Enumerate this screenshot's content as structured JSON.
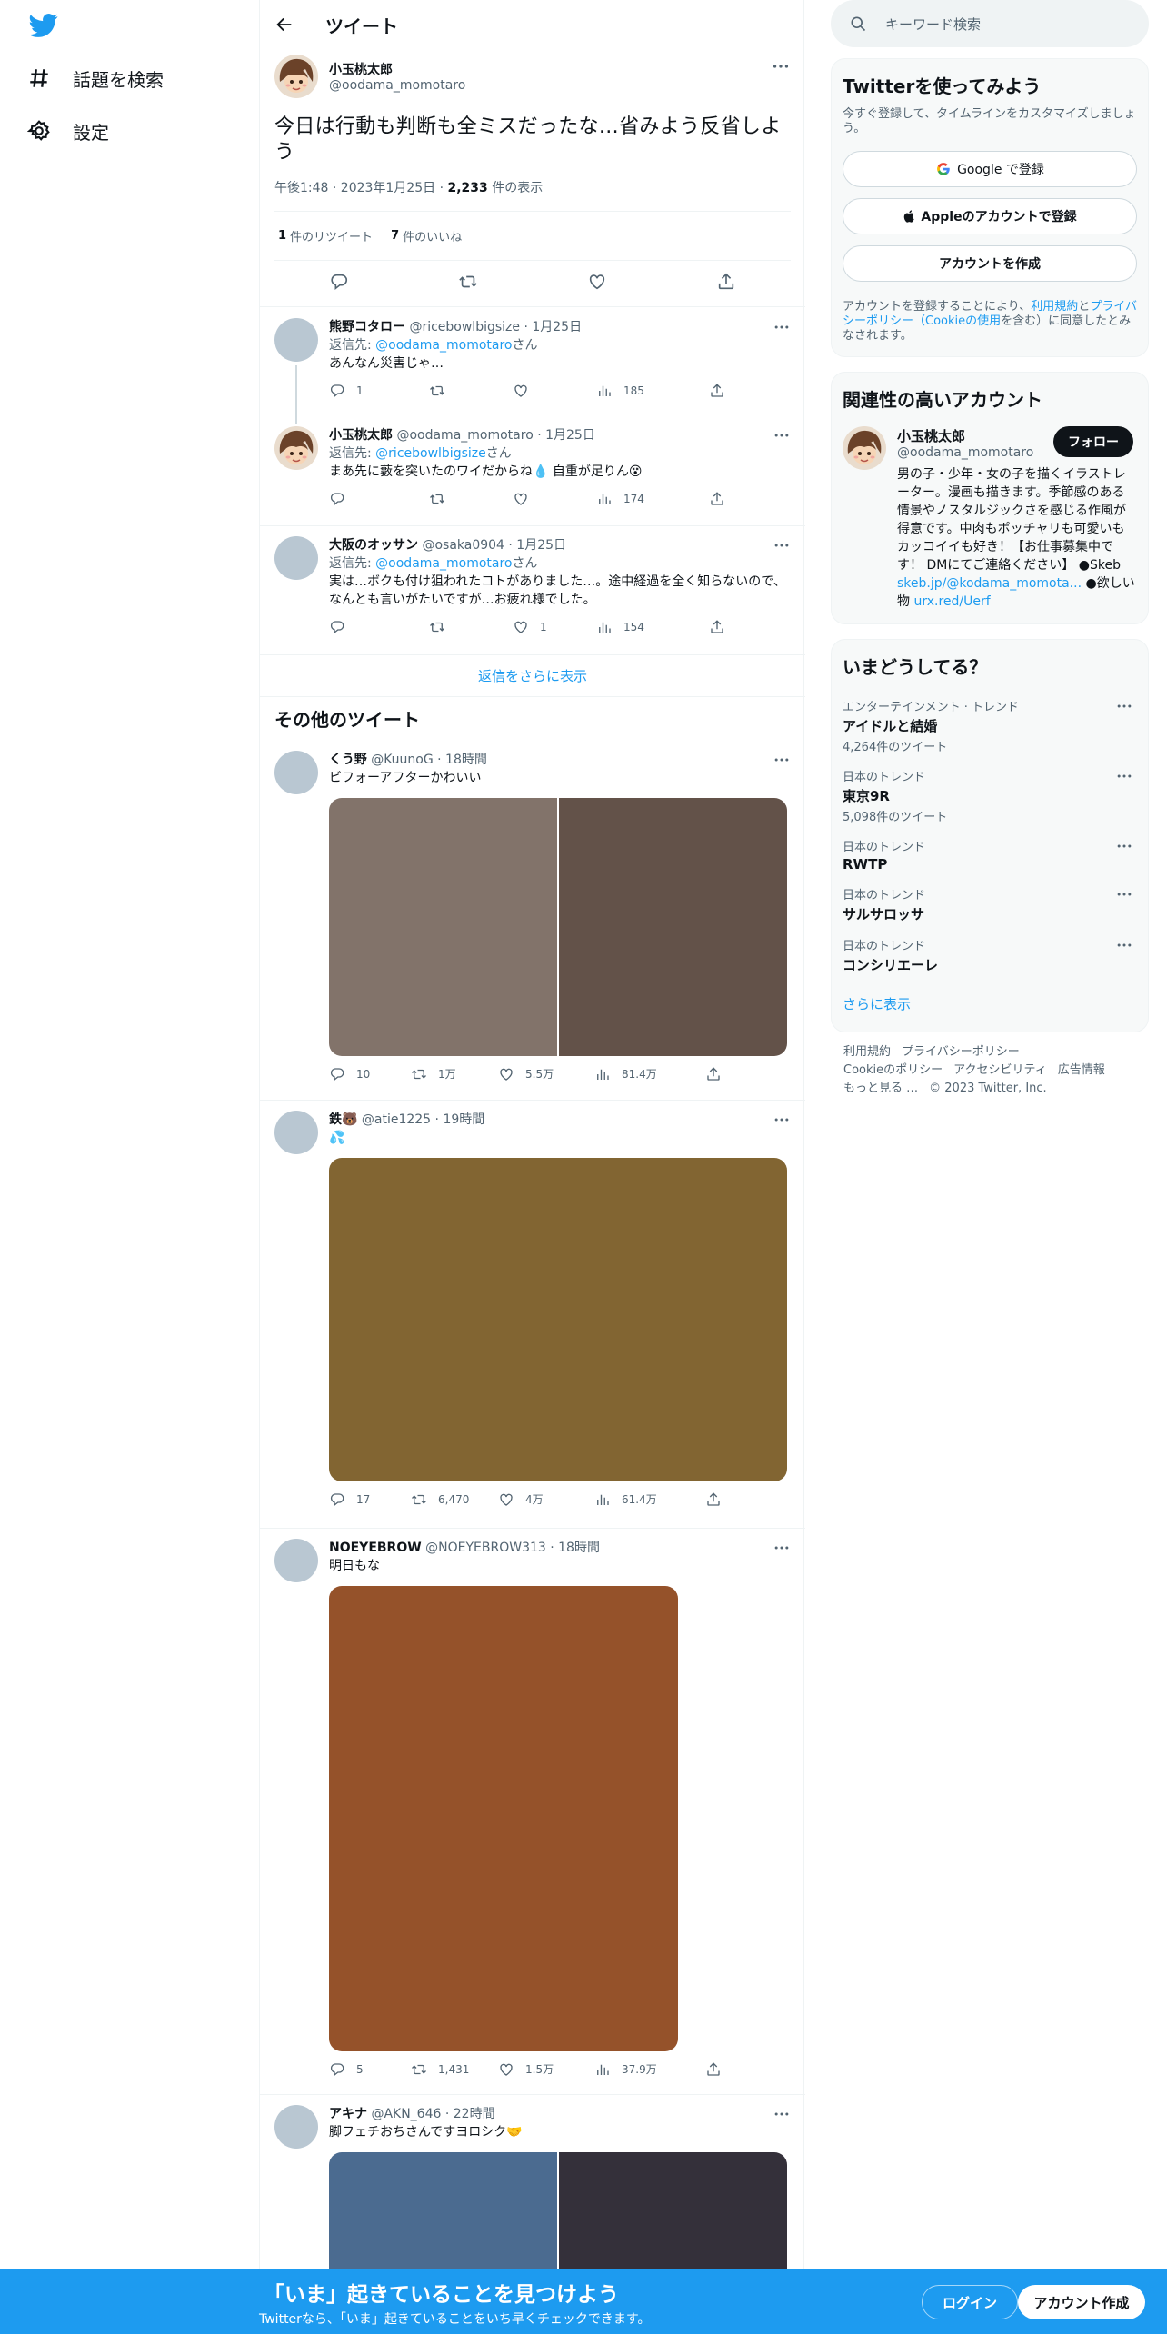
{
  "nav": {
    "explore_label": "話題を検索",
    "settings_label": "設定"
  },
  "header": {
    "title": "ツイート"
  },
  "focus": {
    "name": "小玉桃太郎",
    "handle": "@oodama_momotaro",
    "text": "今日は行動も判断も全ミスだったな…省みよう反省しよう",
    "time": "午後1:48 · 2023年1月25日 · ",
    "views": "2,233",
    "views_label": " 件の表示",
    "retweets": "1",
    "retweets_label": "件のリツイート",
    "likes": "7",
    "likes_label": "件のいいね"
  },
  "replies": [
    {
      "name": "熊野コタロー",
      "meta": "@ricebowlbigsize · 1月25日",
      "reply_prefix": "返信先: ",
      "reply_to": "@oodama_momotaro",
      "reply_suffix": "さん",
      "text": "あんなん災害じゃ…",
      "replies": "1",
      "retweets": "",
      "likes": "",
      "views": "185"
    },
    {
      "name": "小玉桃太郎",
      "meta": "@oodama_momotaro · 1月25日",
      "reply_prefix": "返信先: ",
      "reply_to": "@ricebowlbigsize",
      "reply_suffix": "さん",
      "text": "まあ先に藪を突いたのワイだからね💧 自重が足りん😵",
      "replies": "",
      "retweets": "",
      "likes": "",
      "views": "174"
    },
    {
      "name": "大阪のオッサン",
      "meta": "@osaka0904 · 1月25日",
      "reply_prefix": "返信先: ",
      "reply_to": "@oodama_momotaro",
      "reply_suffix": "さん",
      "text": "実は…ボクも付け狙われたコトがありました…。途中経過を全く知らないので、なんとも言いがたいですが…お疲れ様でした。",
      "replies": "",
      "retweets": "",
      "likes": "1",
      "views": "154"
    }
  ],
  "more_replies": "返信をさらに表示",
  "other_title": "その他のツイート",
  "other_tweets": [
    {
      "name": "くう野",
      "meta": "@KuunoG · 18時間",
      "text": "ビフォーアフターかわいい",
      "replies": "10",
      "retweets": "1万",
      "likes": "5.5万",
      "views": "81.4万",
      "colors": [
        "#82736a",
        "#635249"
      ]
    },
    {
      "name": "鉄🐻",
      "meta": "@atie1225 · 19時間",
      "text": "💦",
      "replies": "17",
      "retweets": "6,470",
      "likes": "4万",
      "views": "61.4万",
      "colors": [
        "#826532"
      ]
    },
    {
      "name": "NOEYEBROW",
      "meta": "@NOEYEBROW313 · 18時間",
      "text": "明日もな",
      "replies": "5",
      "retweets": "1,431",
      "likes": "1.5万",
      "views": "37.9万",
      "colors": [
        "#95522a"
      ]
    },
    {
      "name": "アキナ",
      "meta": "@AKN_646 · 22時間",
      "text": "脚フェチおちさんですヨロシク🤝",
      "colors": [
        "#4b6b90",
        "#34303a"
      ]
    }
  ],
  "search": {
    "placeholder": "キーワード検索"
  },
  "signup": {
    "title": "Twitterを使ってみよう",
    "desc": "今すぐ登録して、タイムラインをカスタマイズしましょう。",
    "google": "Google で登録",
    "apple": "Appleのアカウントで登録",
    "create": "アカウントを作成",
    "terms_pre": "アカウントを登録することにより、",
    "terms_link": "利用規約",
    "terms_and": "と",
    "privacy_link": "プライバシーポリシー（Cookieの使用",
    "terms_post": "を含む）に同意したとみなされます。"
  },
  "related": {
    "title": "関連性の高いアカウント",
    "name": "小玉桃太郎",
    "handle": "@oodama_momotaro",
    "follow": "フォロー",
    "bio": "男の子・少年・女の子を描くイラストレーター。漫画も描きます。季節感のある情景やノスタルジックさを感じる作風が得意です。中肉もポッチャリも可愛いもカッコイイも好き！【お仕事募集中です！ DMにてご連絡ください】 ●Skeb",
    "link1": "skeb.jp/@kodama_momota...",
    "bio2": " ●欲しい物 ",
    "link2": "urx.red/Uerf"
  },
  "trends": {
    "title": "いまどうしてる？",
    "items": [
      {
        "category": "エンターテインメント · トレンド",
        "name": "アイドルと結婚",
        "count": "4,264件のツイート"
      },
      {
        "category": "日本のトレンド",
        "name": "東京9R",
        "count": "5,098件のツイート"
      },
      {
        "category": "日本のトレンド",
        "name": "RWTP",
        "count": ""
      },
      {
        "category": "日本のトレンド",
        "name": "サルサロッサ",
        "count": ""
      },
      {
        "category": "日本のトレンド",
        "name": "コンシリエーレ",
        "count": ""
      }
    ],
    "show_more": "さらに表示"
  },
  "footer": {
    "l1": [
      "利用規約",
      "プライバシーポリシー"
    ],
    "l2": [
      "Cookieのポリシー",
      "アクセシビリティ",
      "広告情報"
    ],
    "more": "もっと見る …",
    "copyright": "© 2023 Twitter, Inc."
  },
  "bottom": {
    "title": "「いま」起きていることを見つけよう",
    "sub": "Twitterなら、「いま」起きていることをいち早くチェックできます。",
    "login": "ログイン",
    "signup": "アカウント作成"
  },
  "colors": {
    "accent": "#1d9bf0",
    "text": "#0f1419",
    "muted": "#536471"
  }
}
